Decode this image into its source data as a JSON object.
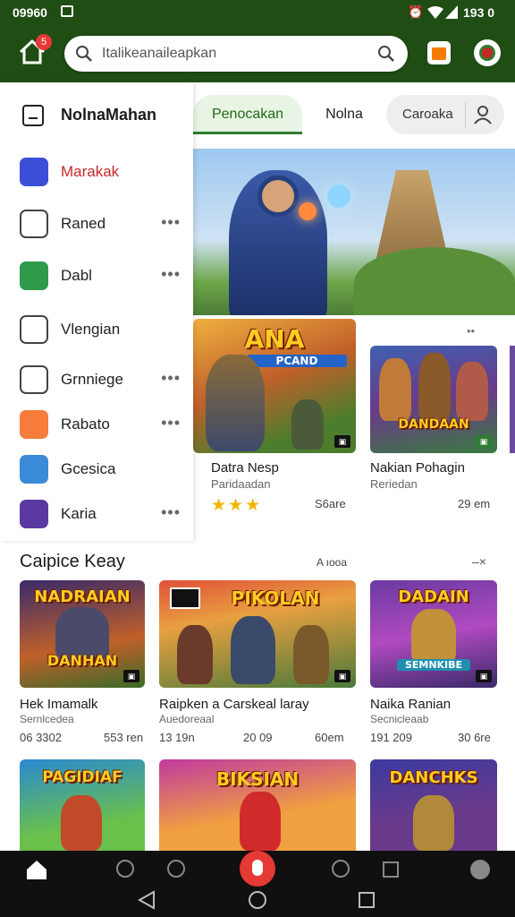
{
  "status": {
    "left": "09960",
    "time": "193 0"
  },
  "search": {
    "placeholder": "Italikeanaileapkan"
  },
  "notification_count": "5",
  "drawer": {
    "title": "NolnaMahan",
    "items": [
      {
        "label": "Marakak",
        "icon": "game-shield-icon",
        "color": "#c62828",
        "dots": false
      },
      {
        "label": "Raned",
        "icon": "list-icon",
        "color": "#222222",
        "dots": true
      },
      {
        "label": "Dabl",
        "icon": "sword-icon",
        "color": "#222222",
        "dots": true
      },
      {
        "label": "Vlengian",
        "icon": "ticket-icon",
        "color": "#222222",
        "dots": false
      },
      {
        "label": "Grnniege",
        "icon": "cube-icon",
        "color": "#222222",
        "dots": true
      },
      {
        "label": "Rabato",
        "icon": "colorful-game-icon",
        "color": "#222222",
        "dots": true
      },
      {
        "label": "Gcesica",
        "icon": "hero-game-icon",
        "color": "#222222",
        "dots": false
      },
      {
        "label": "Karia",
        "icon": "purple-game-icon",
        "color": "#222222",
        "dots": true
      }
    ]
  },
  "tabs": {
    "active": "Penocakan",
    "second": "Nolna",
    "third": "Caroaka"
  },
  "featured": [
    {
      "art_title": "ANA",
      "art_subtitle": "PCAND",
      "name": "Datra Nesp",
      "sub": "Paridaadan",
      "meta": "S6are",
      "rating": 3
    },
    {
      "art_title": "DANDAAN",
      "name": "Nakian Pohagin",
      "sub": "Reriedan",
      "meta": "29 em"
    }
  ],
  "section": {
    "title": "Caipice Keay",
    "action": "A ıooa"
  },
  "grid": [
    {
      "art_title": "NADRAIAN",
      "art_subtitle": "DANHAN",
      "name": "Hek Imamalk",
      "sub": "Sernlcedea",
      "meta_left": "06 3302",
      "meta_right": "553 ren"
    },
    {
      "art_title": "PIKOLAN",
      "name": "Raipken a Carskeal laray",
      "sub": "Auedoreaal",
      "meta_left": "13 19n",
      "meta_mid": "20 09",
      "meta_right": "60em"
    },
    {
      "art_title": "DADAIN",
      "art_subtitle": "SEMNKIBE",
      "name": "Naika Ranian",
      "sub": "Secnicleaab",
      "meta_left": "191 209",
      "meta_right": "30 6re"
    }
  ],
  "bottom_row": [
    {
      "art_title": "PAGIDIAF"
    },
    {
      "art_title": "BIKSIAN"
    },
    {
      "art_title": "DANCHKS"
    }
  ],
  "colors": {
    "brand_green": "#1f4d14",
    "accent_red": "#e53935"
  }
}
